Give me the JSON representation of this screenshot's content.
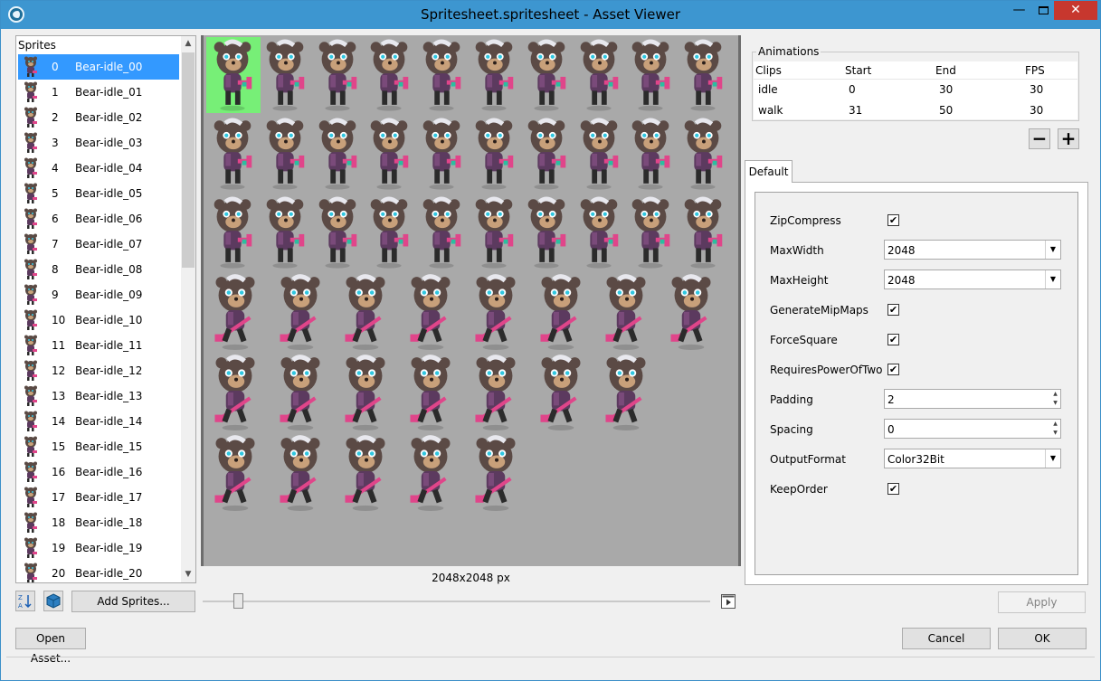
{
  "window": {
    "title": "Spritesheet.spritesheet - Asset Viewer",
    "min_glyph": "—",
    "close_glyph": "✕"
  },
  "sprites": {
    "header": "Sprites",
    "selected_index": 0,
    "items": [
      {
        "index": "0",
        "label": "Bear-idle_00"
      },
      {
        "index": "1",
        "label": "Bear-idle_01"
      },
      {
        "index": "2",
        "label": "Bear-idle_02"
      },
      {
        "index": "3",
        "label": "Bear-idle_03"
      },
      {
        "index": "4",
        "label": "Bear-idle_04"
      },
      {
        "index": "5",
        "label": "Bear-idle_05"
      },
      {
        "index": "6",
        "label": "Bear-idle_06"
      },
      {
        "index": "7",
        "label": "Bear-idle_07"
      },
      {
        "index": "8",
        "label": "Bear-idle_08"
      },
      {
        "index": "9",
        "label": "Bear-idle_09"
      },
      {
        "index": "10",
        "label": "Bear-idle_10"
      },
      {
        "index": "11",
        "label": "Bear-idle_11"
      },
      {
        "index": "12",
        "label": "Bear-idle_12"
      },
      {
        "index": "13",
        "label": "Bear-idle_13"
      },
      {
        "index": "14",
        "label": "Bear-idle_14"
      },
      {
        "index": "15",
        "label": "Bear-idle_15"
      },
      {
        "index": "16",
        "label": "Bear-idle_16"
      },
      {
        "index": "17",
        "label": "Bear-idle_17"
      },
      {
        "index": "18",
        "label": "Bear-idle_18"
      },
      {
        "index": "19",
        "label": "Bear-idle_19"
      },
      {
        "index": "20",
        "label": "Bear-idle_20"
      }
    ]
  },
  "preview": {
    "size_label": "2048x2048 px",
    "rows": [
      10,
      10,
      10,
      8,
      7,
      5
    ]
  },
  "controls": {
    "add_sprites_label": "Add Sprites...",
    "open_asset_label": "Open Asset...",
    "zoom_level": 0.06
  },
  "animations": {
    "legend": "Animations",
    "columns": [
      "Clips",
      "Start",
      "End",
      "FPS"
    ],
    "clips": [
      {
        "name": "idle",
        "start": "0",
        "end": "30",
        "fps": "30"
      },
      {
        "name": "walk",
        "start": "31",
        "end": "50",
        "fps": "30"
      }
    ]
  },
  "settings": {
    "tab_label": "Default",
    "zip_compress": {
      "label": "ZipCompress",
      "checked": true
    },
    "max_width": {
      "label": "MaxWidth",
      "value": "2048"
    },
    "max_height": {
      "label": "MaxHeight",
      "value": "2048"
    },
    "generate_mipmaps": {
      "label": "GenerateMipMaps",
      "checked": true
    },
    "force_square": {
      "label": "ForceSquare",
      "checked": true
    },
    "requires_pot": {
      "label": "RequiresPowerOfTwo",
      "checked": true
    },
    "padding": {
      "label": "Padding",
      "value": "2"
    },
    "spacing": {
      "label": "Spacing",
      "value": "0"
    },
    "output_format": {
      "label": "OutputFormat",
      "value": "Color32Bit"
    },
    "keep_order": {
      "label": "KeepOrder",
      "checked": true
    },
    "check_glyph": "✔"
  },
  "buttons": {
    "apply": "Apply",
    "cancel": "Cancel",
    "ok": "OK"
  },
  "colors": {
    "title_bar": "#3d96d0",
    "selection": "#3399ff",
    "sprite_highlight": "#77ef77",
    "sheet_background": "#a9a9a9"
  },
  "icons": {
    "sprite_thumbnail": "bear-sprite-icon",
    "sort": "sort-icon",
    "cube": "cube-icon",
    "play": "play-icon",
    "remove": "minus-icon",
    "add": "plus-icon"
  }
}
